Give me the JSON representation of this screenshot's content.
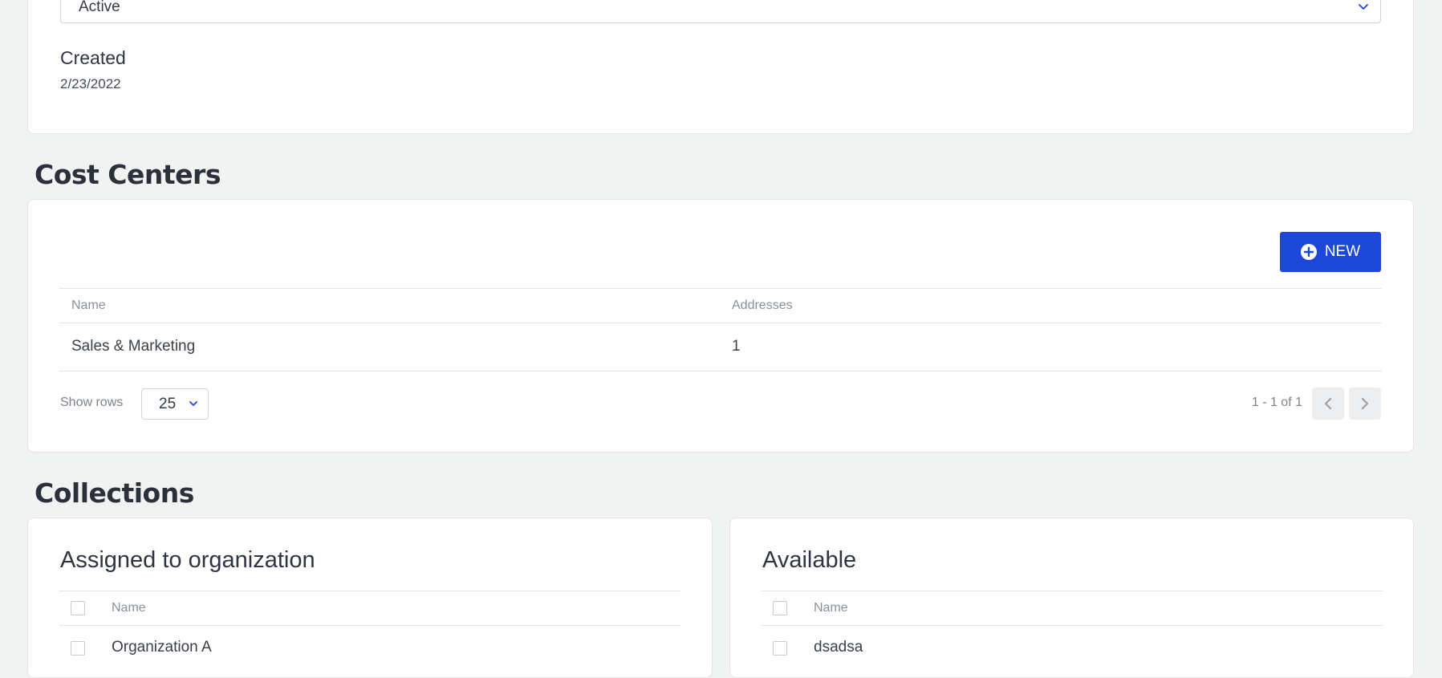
{
  "org_details": {
    "status_value": "Active",
    "created_label": "Created",
    "created_value": "2/23/2022"
  },
  "cost_centers": {
    "heading": "Cost Centers",
    "new_button_label": "NEW",
    "columns": [
      "Name",
      "Addresses"
    ],
    "rows": [
      {
        "name": "Sales & Marketing",
        "addresses": "1"
      }
    ],
    "show_rows_label": "Show rows",
    "rows_per_page": "25",
    "page_info": "1 - 1 of 1"
  },
  "collections": {
    "heading": "Collections",
    "assigned": {
      "title": "Assigned to organization",
      "column": "Name",
      "items": [
        "Organization A"
      ]
    },
    "available": {
      "title": "Available",
      "column": "Name",
      "items": [
        "dsadsa"
      ]
    }
  },
  "colors": {
    "background": "#f1f2f2",
    "card": "#ffffff",
    "accent": "#1c47d9",
    "heading": "#2b313a",
    "muted": "#8a9099"
  },
  "icons": {
    "status_dropdown": "chevron-down-icon",
    "new_button": "plus-circle-icon",
    "rows_dropdown": "chevron-down-icon",
    "prev_page": "chevron-left-icon",
    "next_page": "chevron-right-icon"
  }
}
